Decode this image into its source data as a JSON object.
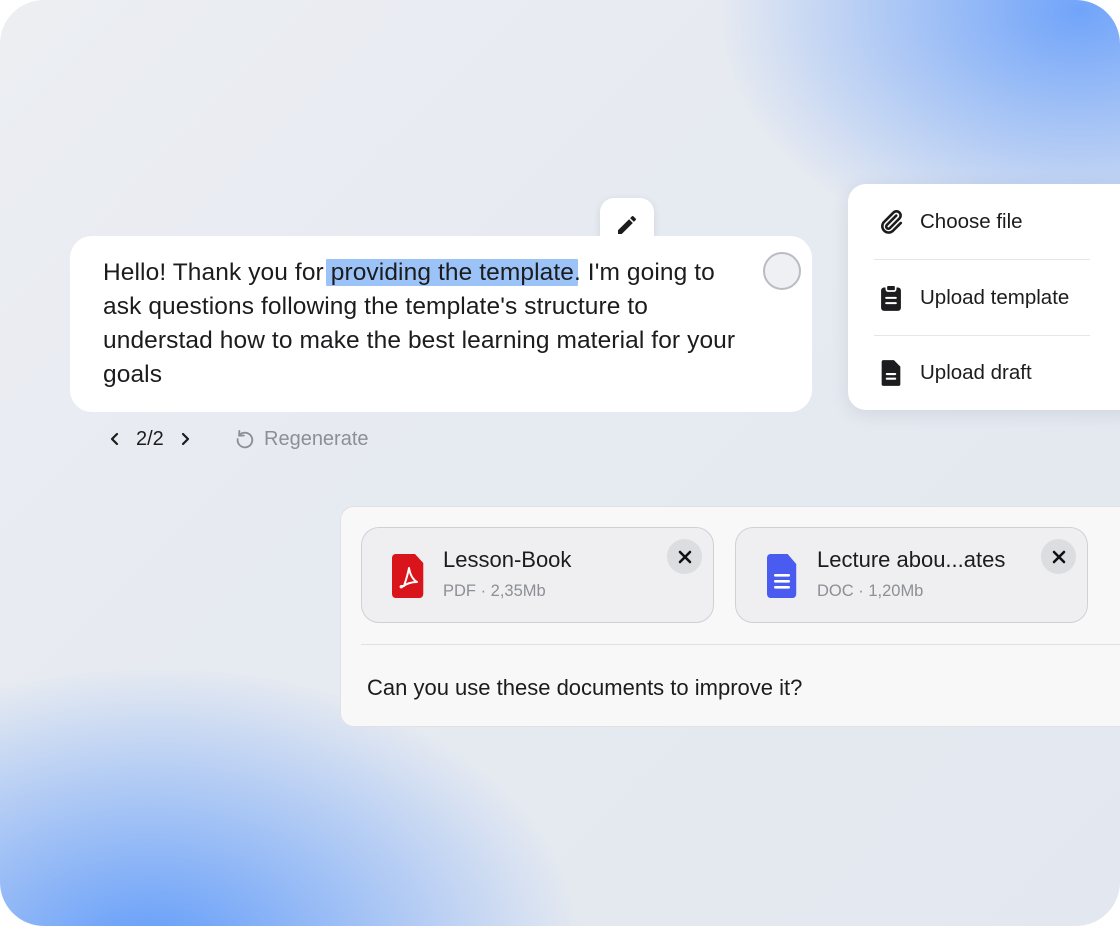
{
  "message": {
    "text_before": "Hello! Thank you for ",
    "text_highlight": "providing the template",
    "text_after": ". I'm going to ask questions following the template's structure to understad how to make the best learning material for your goals"
  },
  "pager": {
    "current": "2/2"
  },
  "regenerate": {
    "label": "Regenerate"
  },
  "attach_menu": {
    "items": [
      {
        "label": "Choose file",
        "icon": "paperclip-icon"
      },
      {
        "label": "Upload template",
        "icon": "clipboard-icon"
      },
      {
        "label": "Upload draft",
        "icon": "document-icon"
      }
    ]
  },
  "composer": {
    "files": [
      {
        "name": "Lesson-Book",
        "meta": "PDF · 2,35Mb",
        "icon": "pdf-file-icon"
      },
      {
        "name": "Lecture abou...ates",
        "meta": "DOC · 1,20Mb",
        "icon": "doc-file-icon"
      }
    ],
    "text": "Can you use these documents to improve it?"
  },
  "colors": {
    "highlight": "#9cc3f7",
    "pdf_red": "#d9141b",
    "doc_blue": "#4a5cf0",
    "accent_blue": "#6aa0fa"
  }
}
